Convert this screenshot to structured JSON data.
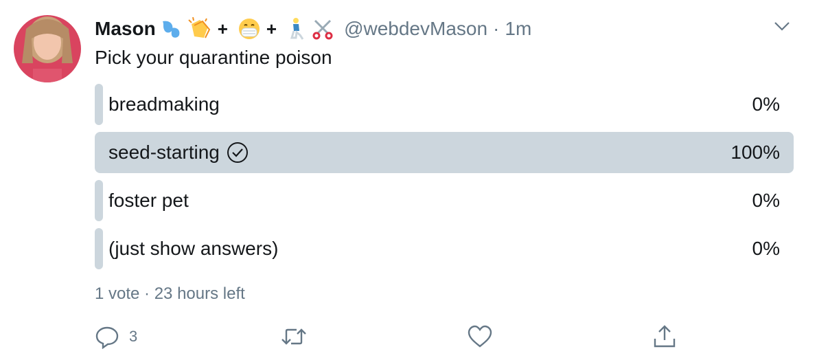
{
  "tweet": {
    "author_name": "Mason",
    "handle": "@webdevMason",
    "separator": "·",
    "time": "1m",
    "plus_1": "+",
    "plus_2": "+",
    "name_emoji": [
      "droplets",
      "clapping-hands",
      "mask-face",
      "kneeling-person",
      "scissors"
    ],
    "text": "Pick your quarantine poison"
  },
  "poll": {
    "options": [
      {
        "label": "breadmaking",
        "percent_text": "0%",
        "percent": 0,
        "selected": false
      },
      {
        "label": "seed-starting",
        "percent_text": "100%",
        "percent": 100,
        "selected": true
      },
      {
        "label": "foster pet",
        "percent_text": "0%",
        "percent": 0,
        "selected": false
      },
      {
        "label": "(just show answers)",
        "percent_text": "0%",
        "percent": 0,
        "selected": false
      }
    ],
    "meta": "1 vote · 23 hours left"
  },
  "actions": {
    "reply_count": "3",
    "icons": [
      "reply-icon",
      "retweet-icon",
      "like-icon",
      "share-icon"
    ]
  },
  "colors": {
    "bar": "#ccd6dd",
    "muted": "#657786",
    "text": "#14171a"
  }
}
